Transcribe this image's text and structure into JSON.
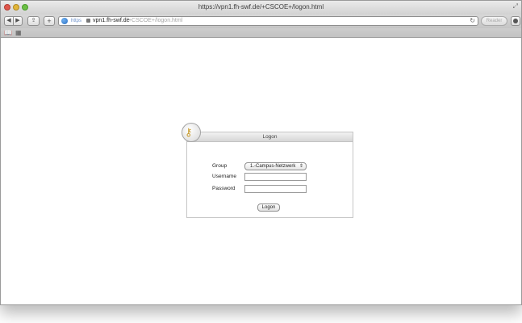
{
  "window": {
    "title": "https://vpn1.fh-swf.de/+CSCOE+/logon.html"
  },
  "toolbar": {
    "url_scheme": "https",
    "url_host": "vpn1.fh-swf.de",
    "url_path": "/+CSCOE+/logon.html",
    "reader_label": "Reader"
  },
  "logon": {
    "title": "Logon",
    "group_label": "Group",
    "group_value": "1.-Campus-Netzwerk",
    "username_label": "Username",
    "password_label": "Password",
    "username_value": "",
    "password_value": "",
    "button_label": "Logon"
  },
  "icons": {
    "back": "back-icon",
    "forward": "forward-icon",
    "share": "share-icon",
    "add": "add-icon",
    "reload": "reload-icon",
    "bookmarks": "bookmarks-icon",
    "top_sites": "top-sites-icon",
    "key": "key-icon"
  }
}
